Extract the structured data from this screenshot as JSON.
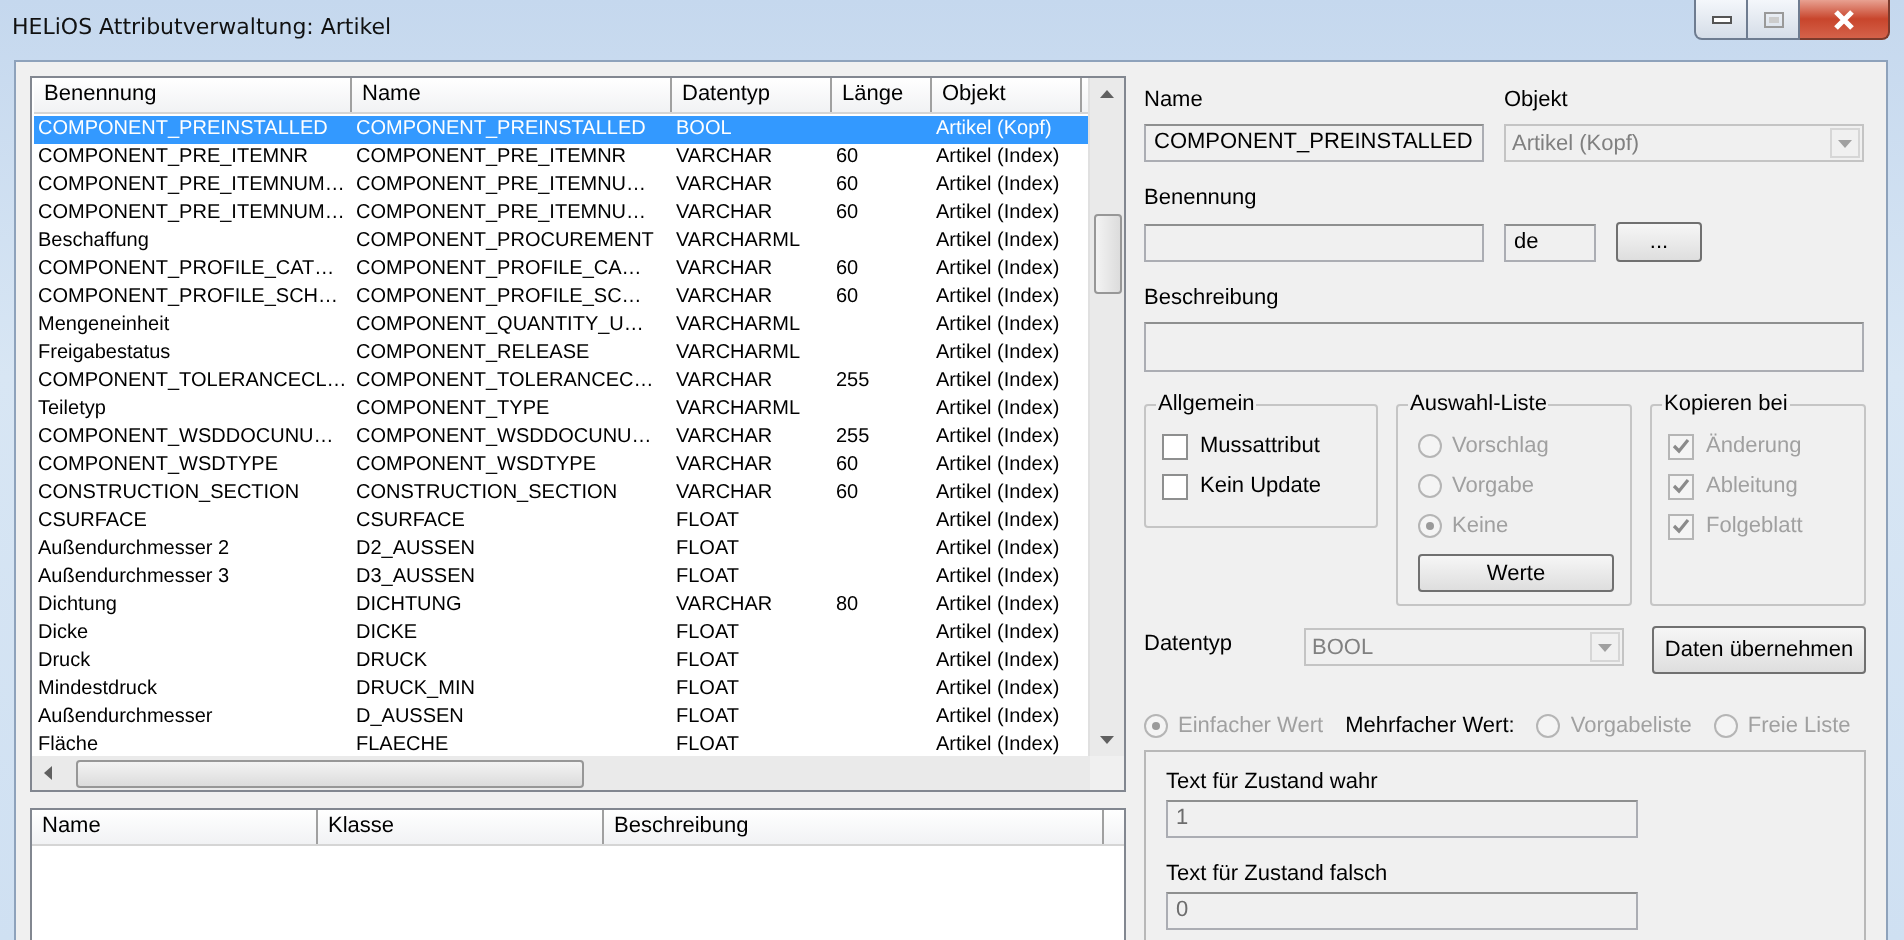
{
  "window": {
    "title": "HELiOS Attributverwaltung: Artikel"
  },
  "attribute_table": {
    "columns": [
      "Benennung",
      "Name",
      "Datentyp",
      "Länge",
      "Objekt"
    ],
    "rows": [
      {
        "cells": [
          "COMPONENT_PREINSTALLED",
          "COMPONENT_PREINSTALLED",
          "BOOL",
          "",
          "Artikel (Kopf)"
        ],
        "selected": true
      },
      {
        "cells": [
          "COMPONENT_PRE_ITEMNR",
          "COMPONENT_PRE_ITEMNR",
          "VARCHAR",
          "60",
          "Artikel (Index)"
        ],
        "selected": false
      },
      {
        "cells": [
          "COMPONENT_PRE_ITEMNUM…",
          "COMPONENT_PRE_ITEMNU…",
          "VARCHAR",
          "60",
          "Artikel (Index)"
        ],
        "selected": false
      },
      {
        "cells": [
          "COMPONENT_PRE_ITEMNUM…",
          "COMPONENT_PRE_ITEMNU…",
          "VARCHAR",
          "60",
          "Artikel (Index)"
        ],
        "selected": false
      },
      {
        "cells": [
          "Beschaffung",
          "COMPONENT_PROCUREMENT",
          "VARCHARML",
          "",
          "Artikel (Index)"
        ],
        "selected": false
      },
      {
        "cells": [
          "COMPONENT_PROFILE_CAT…",
          "COMPONENT_PROFILE_CA…",
          "VARCHAR",
          "60",
          "Artikel (Index)"
        ],
        "selected": false
      },
      {
        "cells": [
          "COMPONENT_PROFILE_SCH…",
          "COMPONENT_PROFILE_SC…",
          "VARCHAR",
          "60",
          "Artikel (Index)"
        ],
        "selected": false
      },
      {
        "cells": [
          "Mengeneinheit",
          "COMPONENT_QUANTITY_U…",
          "VARCHARML",
          "",
          "Artikel (Index)"
        ],
        "selected": false
      },
      {
        "cells": [
          "Freigabestatus",
          "COMPONENT_RELEASE",
          "VARCHARML",
          "",
          "Artikel (Index)"
        ],
        "selected": false
      },
      {
        "cells": [
          "COMPONENT_TOLERANCECL…",
          "COMPONENT_TOLERANCEC…",
          "VARCHAR",
          "255",
          "Artikel (Index)"
        ],
        "selected": false
      },
      {
        "cells": [
          "Teiletyp",
          "COMPONENT_TYPE",
          "VARCHARML",
          "",
          "Artikel (Index)"
        ],
        "selected": false
      },
      {
        "cells": [
          "COMPONENT_WSDDOCUNU…",
          "COMPONENT_WSDDOCUNU…",
          "VARCHAR",
          "255",
          "Artikel (Index)"
        ],
        "selected": false
      },
      {
        "cells": [
          "COMPONENT_WSDTYPE",
          "COMPONENT_WSDTYPE",
          "VARCHAR",
          "60",
          "Artikel (Index)"
        ],
        "selected": false
      },
      {
        "cells": [
          "CONSTRUCTION_SECTION",
          "CONSTRUCTION_SECTION",
          "VARCHAR",
          "60",
          "Artikel (Index)"
        ],
        "selected": false
      },
      {
        "cells": [
          "CSURFACE",
          "CSURFACE",
          "FLOAT",
          "",
          "Artikel (Index)"
        ],
        "selected": false
      },
      {
        "cells": [
          "Außendurchmesser 2",
          "D2_AUSSEN",
          "FLOAT",
          "",
          "Artikel (Index)"
        ],
        "selected": false
      },
      {
        "cells": [
          "Außendurchmesser 3",
          "D3_AUSSEN",
          "FLOAT",
          "",
          "Artikel (Index)"
        ],
        "selected": false
      },
      {
        "cells": [
          "Dichtung",
          "DICHTUNG",
          "VARCHAR",
          "80",
          "Artikel (Index)"
        ],
        "selected": false
      },
      {
        "cells": [
          "Dicke",
          "DICKE",
          "FLOAT",
          "",
          "Artikel (Index)"
        ],
        "selected": false
      },
      {
        "cells": [
          "Druck",
          "DRUCK",
          "FLOAT",
          "",
          "Artikel (Index)"
        ],
        "selected": false
      },
      {
        "cells": [
          "Mindestdruck",
          "DRUCK_MIN",
          "FLOAT",
          "",
          "Artikel (Index)"
        ],
        "selected": false
      },
      {
        "cells": [
          "Außendurchmesser",
          "D_AUSSEN",
          "FLOAT",
          "",
          "Artikel (Index)"
        ],
        "selected": false
      },
      {
        "cells": [
          "Fläche",
          "FLAECHE",
          "FLOAT",
          "",
          "Artikel (Index)"
        ],
        "selected": false
      }
    ]
  },
  "class_table": {
    "columns": [
      "Name",
      "Klasse",
      "Beschreibung"
    ]
  },
  "details": {
    "name": {
      "label": "Name",
      "value": "COMPONENT_PREINSTALLED"
    },
    "objekt": {
      "label": "Objekt",
      "value": "Artikel (Kopf)",
      "disabled": true
    },
    "benennung": {
      "label": "Benennung",
      "language": "de",
      "button": "..."
    },
    "beschreibung": {
      "label": "Beschreibung"
    },
    "groups": [
      {
        "title": "Allgemein",
        "items": [
          {
            "kind": "checkbox",
            "label": "Mussattribut",
            "checked": false,
            "disabled": false
          },
          {
            "kind": "checkbox",
            "label": "Kein Update",
            "checked": false,
            "disabled": false
          }
        ]
      },
      {
        "title": "Auswahl-Liste",
        "items": [
          {
            "kind": "radio",
            "label": "Vorschlag",
            "selected": false,
            "disabled": true
          },
          {
            "kind": "radio",
            "label": "Vorgabe",
            "selected": false,
            "disabled": true
          },
          {
            "kind": "radio",
            "label": "Keine",
            "selected": true,
            "disabled": true
          }
        ],
        "button": "Werte"
      },
      {
        "title": "Kopieren bei",
        "items": [
          {
            "kind": "checkbox",
            "label": "Änderung",
            "checked": true,
            "disabled": true
          },
          {
            "kind": "checkbox",
            "label": "Ableitung",
            "checked": true,
            "disabled": true
          },
          {
            "kind": "checkbox",
            "label": "Folgeblatt",
            "checked": true,
            "disabled": true
          }
        ]
      }
    ],
    "datentyp": {
      "label": "Datentyp",
      "value": "BOOL",
      "disabled": true
    },
    "apply_button": "Daten übernehmen",
    "value_mode": [
      {
        "kind": "radio",
        "label": "Einfacher Wert",
        "selected": true,
        "disabled": true
      },
      {
        "kind": "label",
        "label": "Mehrfacher Wert:"
      },
      {
        "kind": "radio",
        "label": "Vorgabeliste",
        "selected": false,
        "disabled": true
      },
      {
        "kind": "radio",
        "label": "Freie Liste",
        "selected": false,
        "disabled": true
      }
    ],
    "true_text": {
      "label": "Text für Zustand wahr",
      "value": "1"
    },
    "false_text": {
      "label": "Text für Zustand falsch",
      "value": "0"
    }
  }
}
